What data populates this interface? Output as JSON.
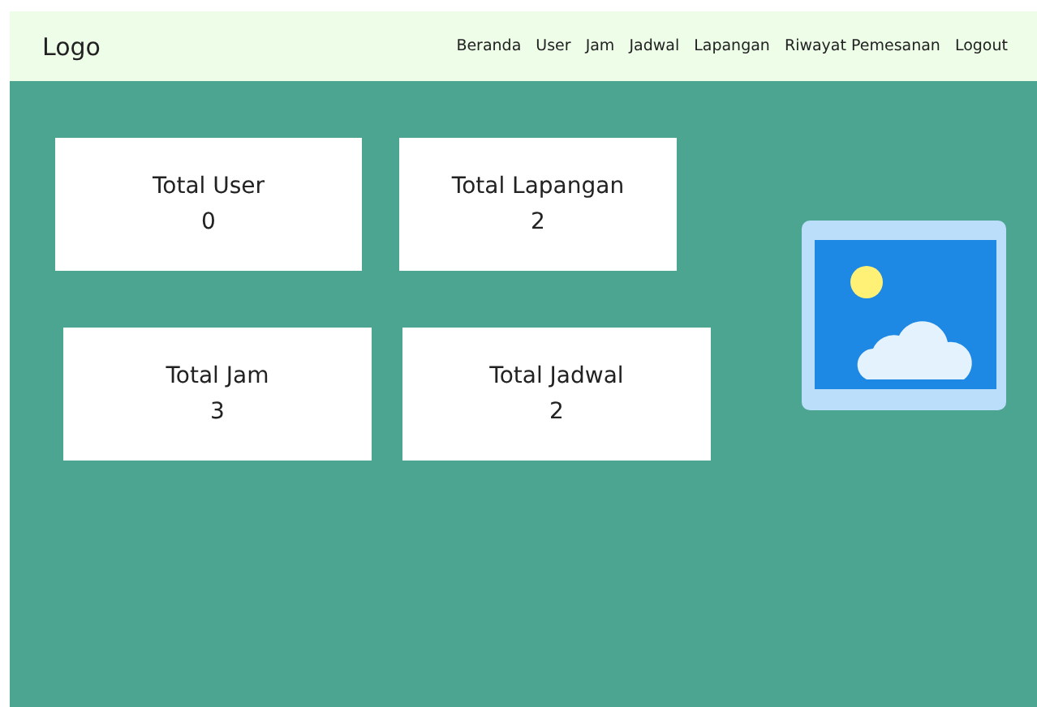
{
  "navbar": {
    "logo": "Logo",
    "links": [
      "Beranda",
      "User",
      "Jam",
      "Jadwal",
      "Lapangan",
      "Riwayat Pemesanan",
      "Logout"
    ]
  },
  "stat_rows": [
    [
      {
        "label": "Total User",
        "value": "0"
      },
      {
        "label": "Total Lapangan",
        "value": "2"
      }
    ],
    [
      {
        "label": "Total Jam",
        "value": "3"
      },
      {
        "label": "Total Jadwal",
        "value": "2"
      }
    ]
  ]
}
